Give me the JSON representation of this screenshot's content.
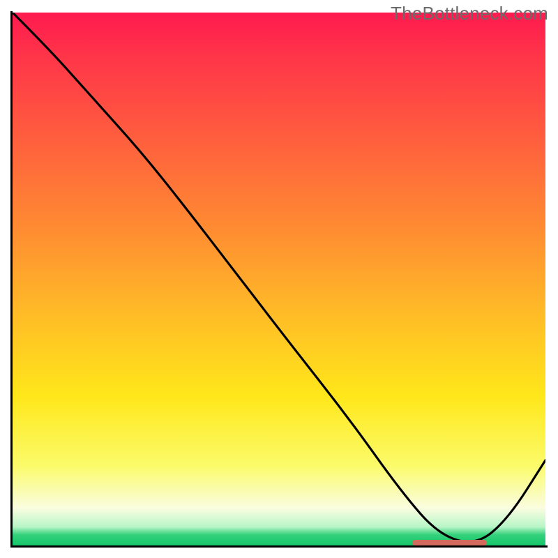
{
  "watermark": "TheBottleneck.com",
  "chart_data": {
    "type": "line",
    "title": "",
    "xlabel": "",
    "ylabel": "",
    "xlim": [
      0,
      1
    ],
    "ylim": [
      0,
      1
    ],
    "x": [
      0.0,
      0.07,
      0.15,
      0.24,
      0.32,
      0.42,
      0.52,
      0.63,
      0.73,
      0.8,
      0.87,
      0.93,
      1.0
    ],
    "values": [
      1.0,
      0.93,
      0.84,
      0.74,
      0.64,
      0.51,
      0.38,
      0.24,
      0.1,
      0.02,
      0.0,
      0.05,
      0.16
    ],
    "gradient_stops": [
      {
        "pos": 0.0,
        "color": "#ff1a4f"
      },
      {
        "pos": 0.4,
        "color": "#ff8a32"
      },
      {
        "pos": 0.72,
        "color": "#ffe71a"
      },
      {
        "pos": 0.93,
        "color": "#fafde0"
      },
      {
        "pos": 1.0,
        "color": "#15c66b"
      }
    ],
    "marker": {
      "x_start": 0.75,
      "x_end": 0.89,
      "y": 0.0,
      "color": "#d36a5e"
    }
  }
}
